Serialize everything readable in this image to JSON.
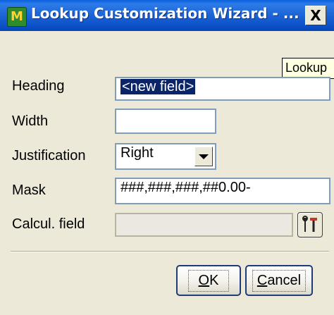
{
  "window": {
    "title": "Lookup Customization Wizard - ...",
    "close_label": "X",
    "app_icon": "app-icon"
  },
  "tooltip": {
    "text": "Lookup"
  },
  "form": {
    "heading": {
      "label": "Heading",
      "value": "<new field>"
    },
    "width": {
      "label": "Width",
      "value": ""
    },
    "justification": {
      "label": "Justification",
      "value": "Right"
    },
    "mask": {
      "label": "Mask",
      "value": "###,###,###,##0.00-"
    },
    "calcul_field": {
      "label": "Calcul. field",
      "value": ""
    }
  },
  "buttons": {
    "ok": {
      "accel": "O",
      "rest": "K"
    },
    "cancel": {
      "accel": "C",
      "rest": "ancel"
    }
  },
  "colors": {
    "title_bar": "#0A4FC7",
    "dialog_bg": "#ECE9D8",
    "selection": "#0A246A",
    "tooltip_bg": "#FFFFE1"
  }
}
